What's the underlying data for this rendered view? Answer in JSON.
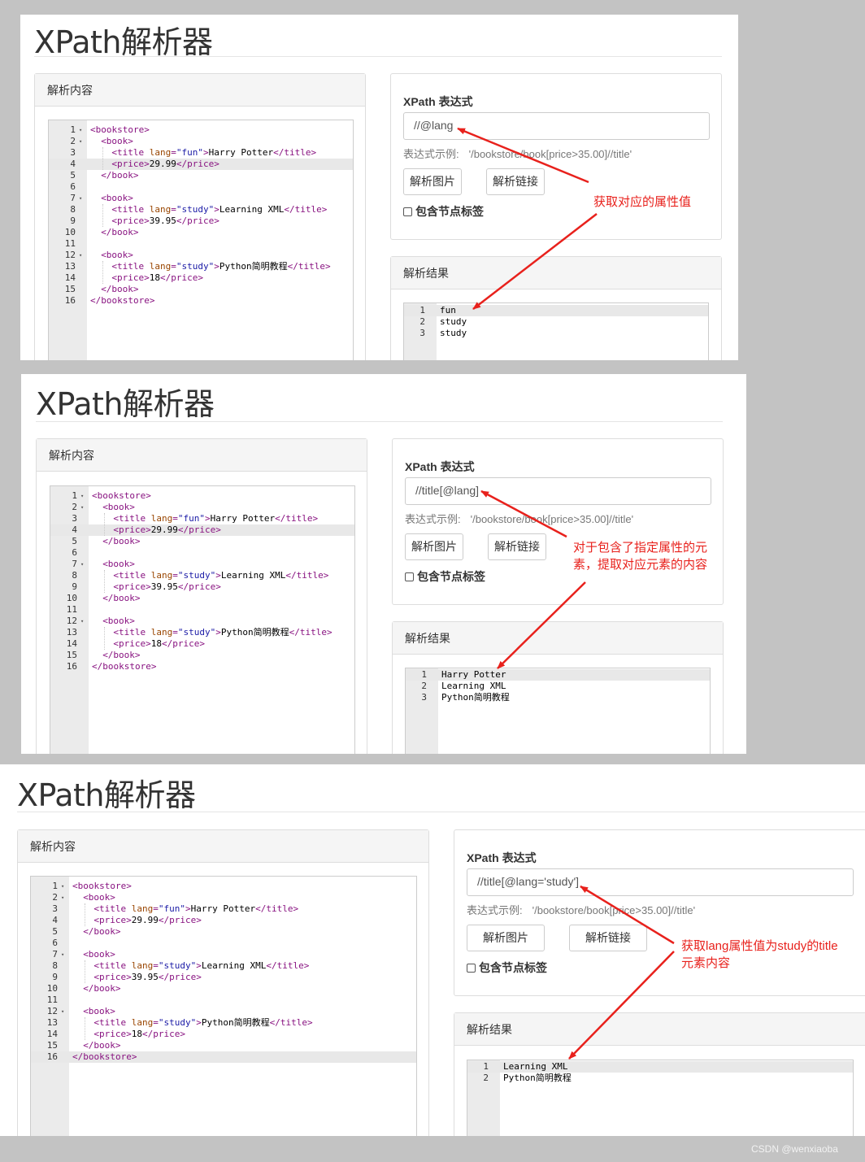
{
  "app_title": "XPath解析器",
  "content_panel_title": "解析内容",
  "xpath_label": "XPath 表达式",
  "example_label": "表达式示例:",
  "example_value": "'/bookstore/book[price>35.00]//title'",
  "btn_parse_image": "解析图片",
  "btn_parse_link": "解析链接",
  "include_tags_label": "包含节点标签",
  "result_panel_title": "解析结果",
  "xml_lines": [
    [
      {
        "c": "tag",
        "t": "<bookstore>"
      }
    ],
    [
      {
        "c": "tag",
        "t": "<book>"
      }
    ],
    [
      {
        "c": "tag",
        "t": "<title "
      },
      {
        "c": "attr",
        "t": "lang"
      },
      {
        "c": "tag",
        "t": "="
      },
      {
        "c": "val",
        "t": "\"fun\""
      },
      {
        "c": "tag",
        "t": ">"
      },
      {
        "c": "txt",
        "t": "Harry Potter"
      },
      {
        "c": "tag",
        "t": "</title>"
      }
    ],
    [
      {
        "c": "tag",
        "t": "<price>"
      },
      {
        "c": "txt",
        "t": "29.99"
      },
      {
        "c": "tag",
        "t": "</price>"
      }
    ],
    [
      {
        "c": "tag",
        "t": "</book>"
      }
    ],
    [],
    [
      {
        "c": "tag",
        "t": "<book>"
      }
    ],
    [
      {
        "c": "tag",
        "t": "<title "
      },
      {
        "c": "attr",
        "t": "lang"
      },
      {
        "c": "tag",
        "t": "="
      },
      {
        "c": "val",
        "t": "\"study\""
      },
      {
        "c": "tag",
        "t": ">"
      },
      {
        "c": "txt",
        "t": "Learning XML"
      },
      {
        "c": "tag",
        "t": "</title>"
      }
    ],
    [
      {
        "c": "tag",
        "t": "<price>"
      },
      {
        "c": "txt",
        "t": "39.95"
      },
      {
        "c": "tag",
        "t": "</price>"
      }
    ],
    [
      {
        "c": "tag",
        "t": "</book>"
      }
    ],
    [],
    [
      {
        "c": "tag",
        "t": "<book>"
      }
    ],
    [
      {
        "c": "tag",
        "t": "<title "
      },
      {
        "c": "attr",
        "t": "lang"
      },
      {
        "c": "tag",
        "t": "="
      },
      {
        "c": "val",
        "t": "\"study\""
      },
      {
        "c": "tag",
        "t": ">"
      },
      {
        "c": "txt",
        "t": "Python简明教程"
      },
      {
        "c": "tag",
        "t": "</title>"
      }
    ],
    [
      {
        "c": "tag",
        "t": "<price>"
      },
      {
        "c": "txt",
        "t": "18"
      },
      {
        "c": "tag",
        "t": "</price>"
      }
    ],
    [
      {
        "c": "tag",
        "t": "</book>"
      }
    ],
    [
      {
        "c": "tag",
        "t": "</bookstore>"
      }
    ]
  ],
  "screenshots": [
    {
      "xpath_value": "//@lang",
      "active_line": 4,
      "results": [
        "fun",
        "study",
        "study"
      ],
      "annotation": [
        "获取对应的属性值"
      ]
    },
    {
      "xpath_value": "//title[@lang]",
      "active_line": 4,
      "results": [
        "Harry Potter",
        "Learning XML",
        "Python简明教程"
      ],
      "annotation": [
        "对于包含了指定属性的元",
        "素，提取对应元素的内容"
      ]
    },
    {
      "xpath_value": "//title[@lang='study']",
      "active_line": 16,
      "results": [
        "Learning XML",
        "Python简明教程"
      ],
      "annotation": [
        "获取lang属性值为study的title",
        "元素内容"
      ]
    }
  ],
  "watermark": "CSDN @wenxiaoba",
  "colors": {
    "annotation": "#e8211c",
    "tag": "#881280",
    "attr": "#994500",
    "attr_value": "#1a1aa6",
    "page_background": "#c3c3c3"
  }
}
